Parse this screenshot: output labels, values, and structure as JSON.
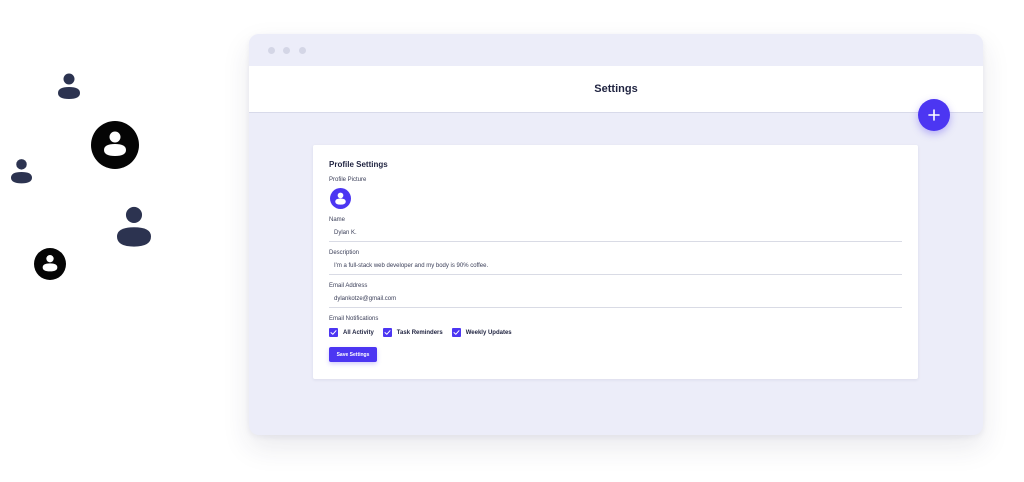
{
  "colors": {
    "accent": "#4c36f2",
    "navy_figure": "#2c3350",
    "black_avatar": "#050505",
    "window_bg": "#ecedf9"
  },
  "decorations": {
    "icons": [
      "user-icon",
      "user-avatar-icon"
    ]
  },
  "header": {
    "title": "Settings",
    "fab_icon": "plus-icon"
  },
  "profile": {
    "heading": "Profile Settings",
    "picture_label": "Profile Picture",
    "name_label": "Name",
    "name_value": "Dylan K.",
    "description_label": "Description",
    "description_value": "I'm a full-stack web developer and my body is 90% coffee.",
    "email_label": "Email Address",
    "email_value": "dylankotze@gmail.com",
    "notifications_label": "Email Notifications",
    "notifications": [
      {
        "label": "All Activity",
        "checked": true
      },
      {
        "label": "Task Reminders",
        "checked": true
      },
      {
        "label": "Weekly Updates",
        "checked": true
      }
    ],
    "save_label": "Save Settings"
  }
}
